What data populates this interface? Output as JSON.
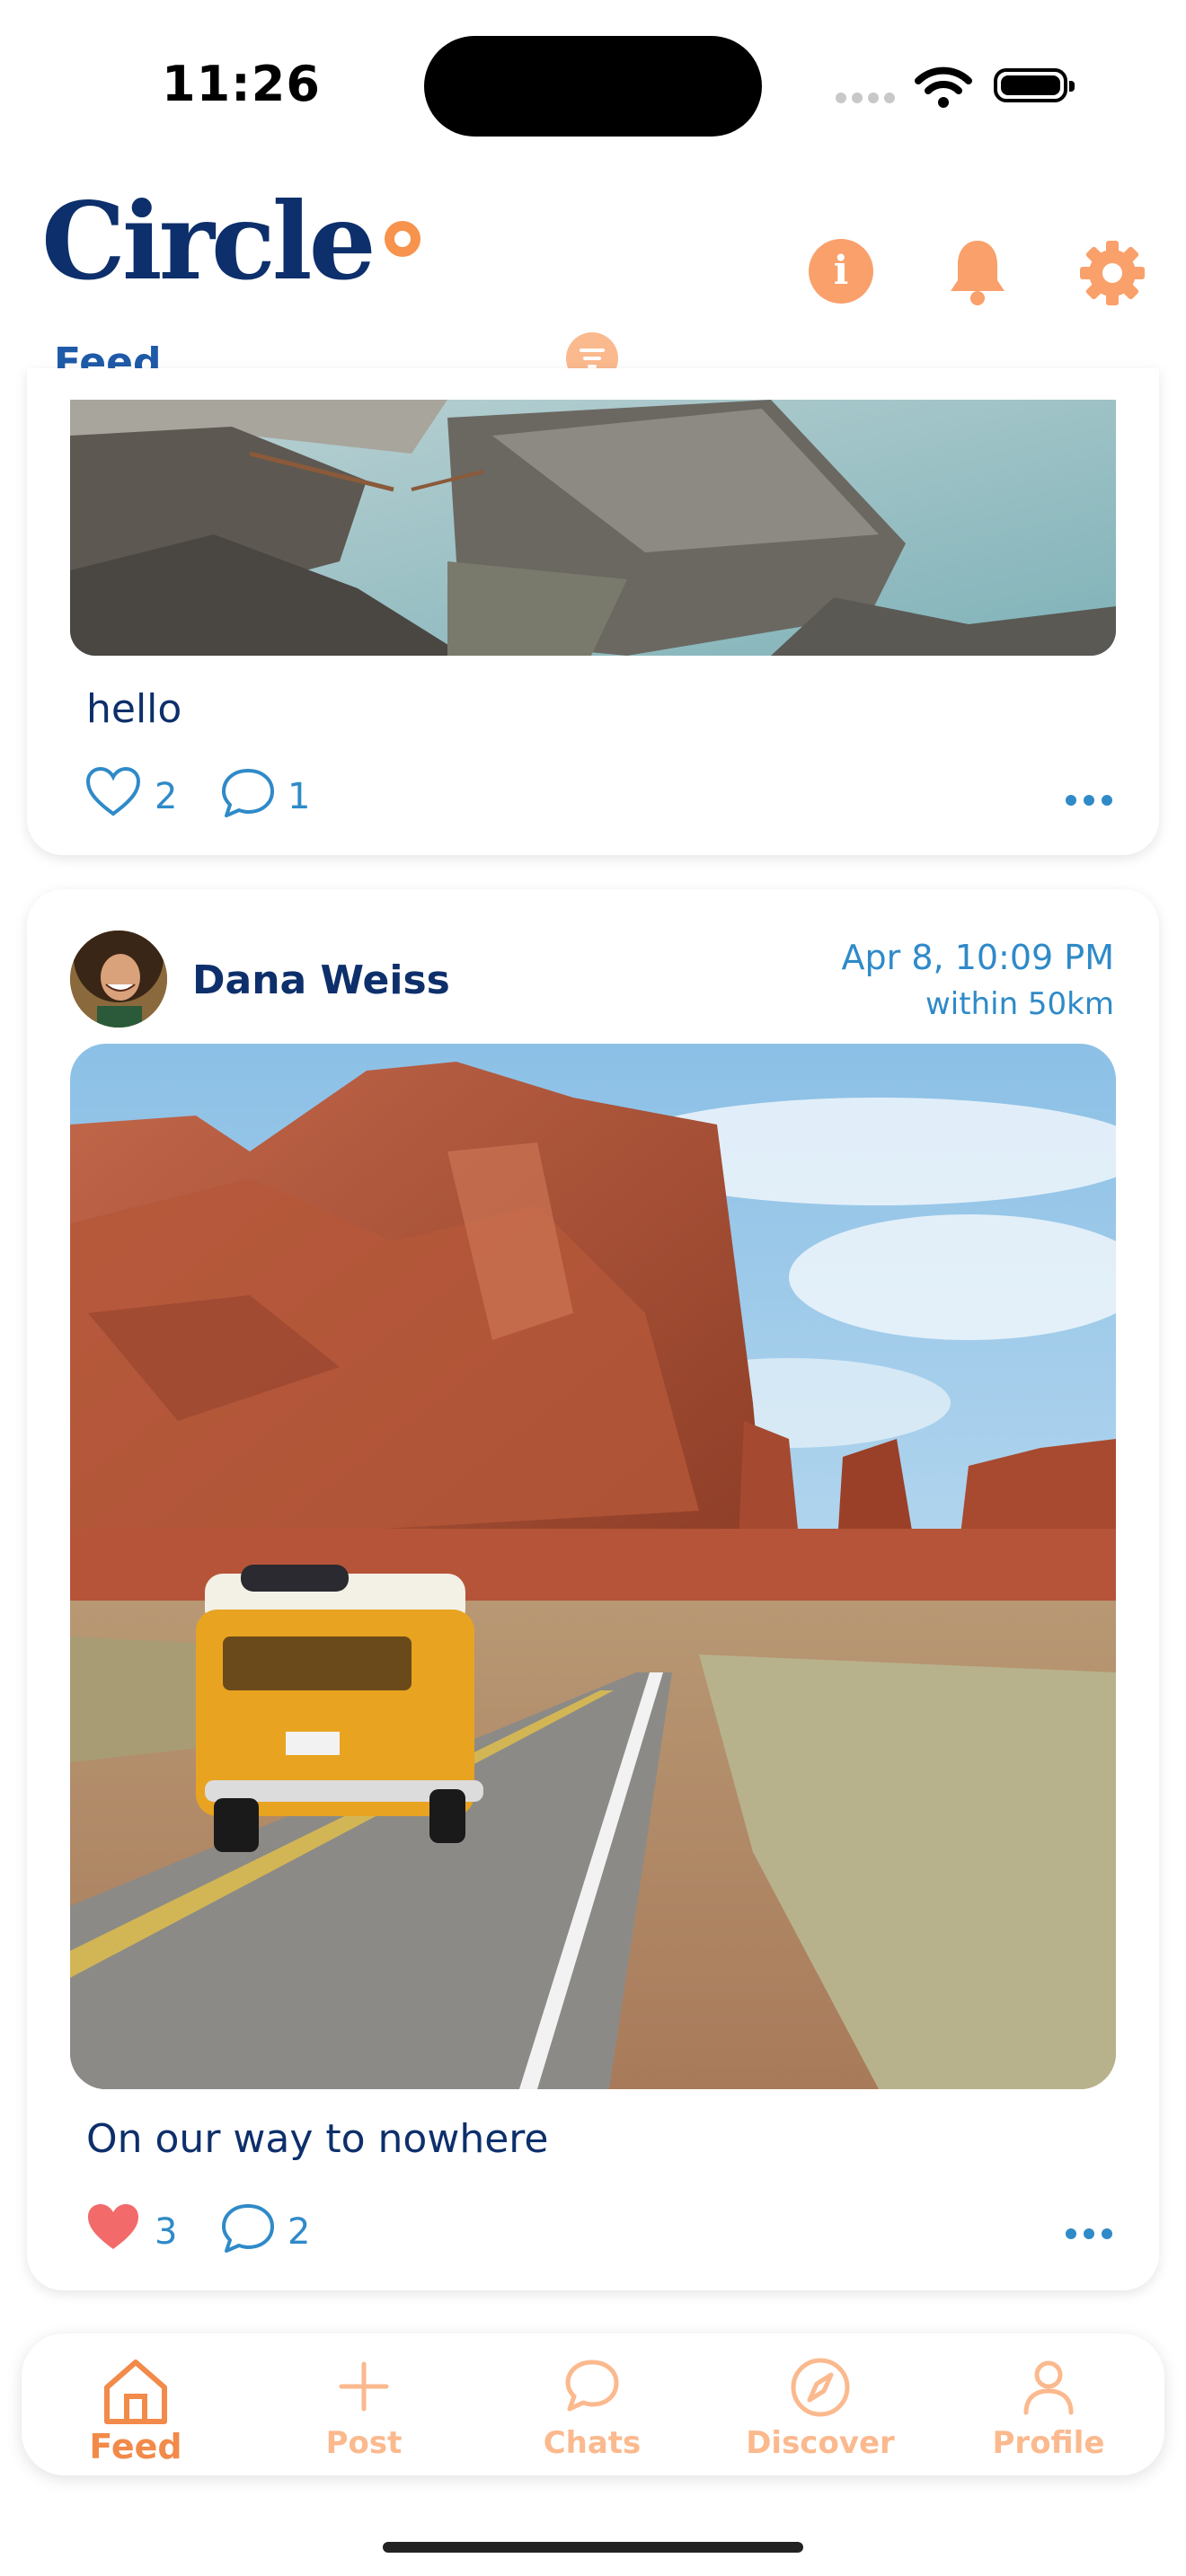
{
  "status_bar": {
    "time": "11:26"
  },
  "header": {
    "logo": "Circle",
    "section_label": "Feed"
  },
  "posts": [
    {
      "caption": "hello",
      "likes": "2",
      "comments": "1",
      "liked": false
    },
    {
      "author": "Dana Weiss",
      "date": "Apr 8, 10:09 PM",
      "distance": "within 50km",
      "caption": "On our way to nowhere",
      "likes": "3",
      "comments": "2",
      "liked": true
    }
  ],
  "tab_bar": {
    "items": [
      {
        "label": "Feed",
        "icon": "home-icon",
        "active": true
      },
      {
        "label": "Post",
        "icon": "plus-icon",
        "active": false
      },
      {
        "label": "Chats",
        "icon": "chat-bubble-icon",
        "active": false
      },
      {
        "label": "Discover",
        "icon": "compass-icon",
        "active": false
      },
      {
        "label": "Profile",
        "icon": "person-icon",
        "active": false
      }
    ]
  },
  "colors": {
    "brand_navy": "#0d2f6b",
    "accent_orange": "#f7934c",
    "link_blue": "#2f8ac8",
    "like_red": "#f26a6a"
  }
}
